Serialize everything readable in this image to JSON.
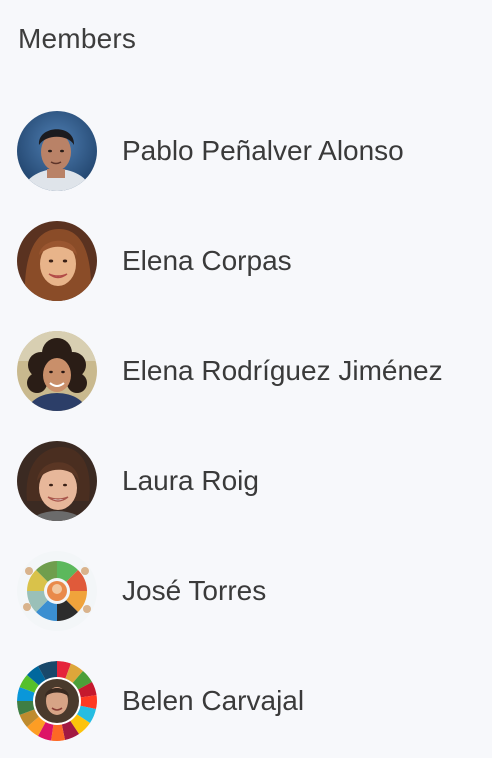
{
  "section": {
    "title": "Members"
  },
  "members": [
    {
      "name": "Pablo Peñalver Alonso",
      "avatar": "photo-man-dark-hair-blue-background"
    },
    {
      "name": "Elena Corpas",
      "avatar": "photo-woman-smiling"
    },
    {
      "name": "Elena Rodríguez Jiménez",
      "avatar": "photo-woman-curly-hair"
    },
    {
      "name": "Laura Roig",
      "avatar": "photo-woman-short-hair"
    },
    {
      "name": "José Torres",
      "avatar": "illustration-cartoon-circle"
    },
    {
      "name": "Belen Carvajal",
      "avatar": "photo-woman-sdg-color-ring"
    }
  ]
}
